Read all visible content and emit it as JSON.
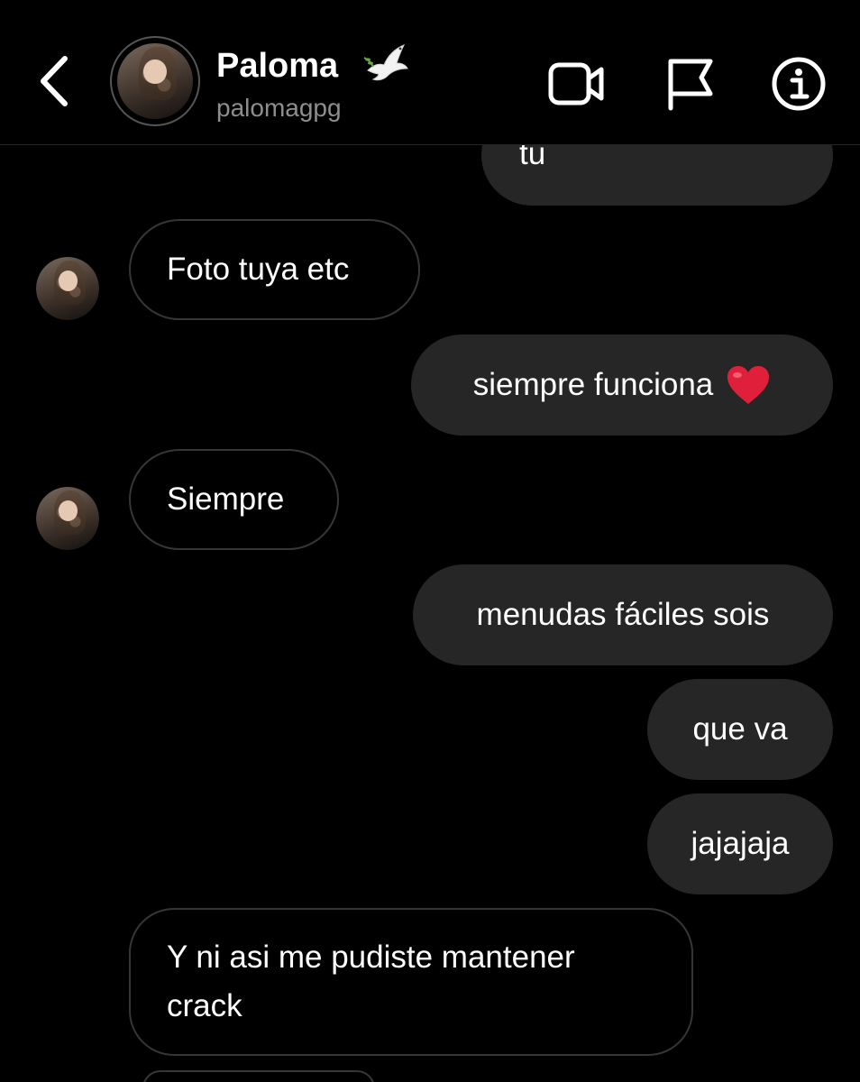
{
  "header": {
    "name": "Paloma",
    "username": "palomagpg",
    "name_emoji": "dove-icon",
    "back_icon": "chevron-left-icon",
    "actions": [
      {
        "icon": "video-camera-icon"
      },
      {
        "icon": "flag-icon"
      },
      {
        "icon": "info-icon"
      }
    ]
  },
  "messages": [
    {
      "from": "me",
      "text": "tu"
    },
    {
      "from": "them",
      "text": "Foto tuya etc"
    },
    {
      "from": "me",
      "text": "siempre funciona",
      "emoji": "red-heart-icon"
    },
    {
      "from": "them",
      "text": "Siempre"
    },
    {
      "from": "me",
      "text": "menudas fáciles sois"
    },
    {
      "from": "me",
      "text": "que va"
    },
    {
      "from": "me",
      "text": "jajajaja"
    },
    {
      "from": "them",
      "text": "Y ni asi me pudiste mantener crack"
    }
  ],
  "colors": {
    "background": "#000000",
    "outgoing_bubble": "#262626",
    "incoming_border": "#363636",
    "username_gray": "#8e8e8e",
    "heart_red": "#e0203a"
  }
}
